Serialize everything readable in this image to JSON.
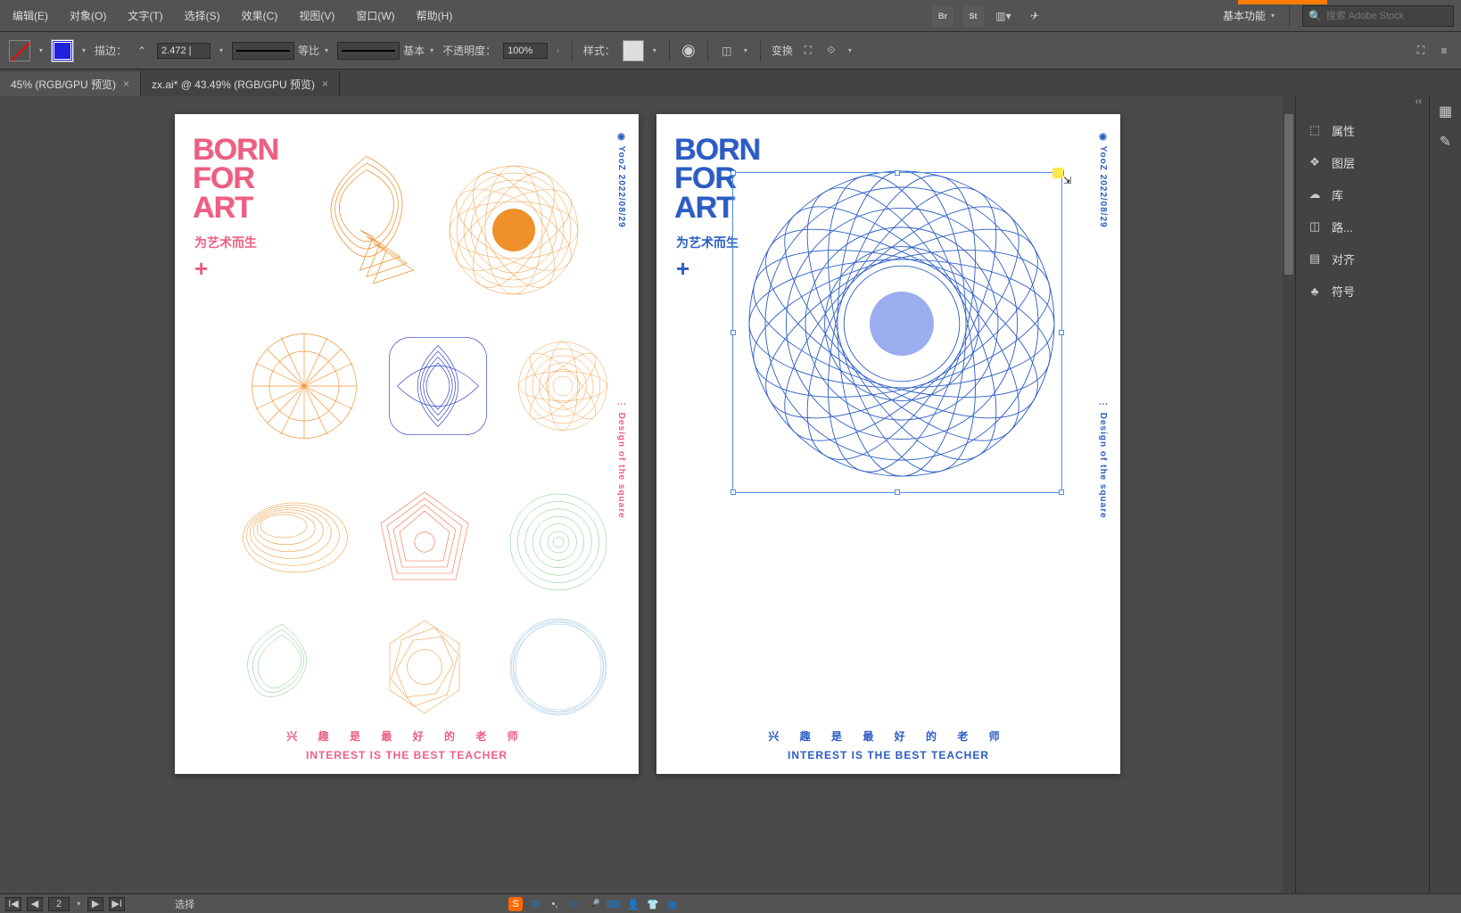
{
  "menu": {
    "items": [
      "编辑(E)",
      "对象(O)",
      "文字(T)",
      "选择(S)",
      "效果(C)",
      "视图(V)",
      "窗口(W)",
      "帮助(H)"
    ],
    "workspace": "基本功能",
    "search_placeholder": "搜索 Adobe Stock"
  },
  "control": {
    "stroke_label": "描边：",
    "stroke_weight": "2.472 |",
    "profile_label": "等比",
    "brush_label": "基本",
    "opacity_label": "不透明度：",
    "opacity_value": "100%",
    "style_label": "样式：",
    "transform_label": "变换"
  },
  "tabs": [
    {
      "label": "45% (RGB/GPU 预览)"
    },
    {
      "label": "zx.ai* @ 43.49% (RGB/GPU 预览)"
    }
  ],
  "panels": {
    "items": [
      {
        "icon": "cube",
        "label": "属性"
      },
      {
        "icon": "layers",
        "label": "图层"
      },
      {
        "icon": "cloud",
        "label": "库"
      },
      {
        "icon": "pathfinder",
        "label": "路..."
      },
      {
        "icon": "align",
        "label": "对齐"
      },
      {
        "icon": "symbol",
        "label": "符号"
      }
    ],
    "expand": "‹‹"
  },
  "status": {
    "artboard": "2",
    "tool": "选择"
  },
  "poster": {
    "title_l1": "BORN",
    "title_l2": "FOR",
    "title_l3": "ART",
    "subtitle": "为艺术而生",
    "plus": "+",
    "side1": "◉ YooZ   2022/08/29",
    "side2": "⋮    Design of the square",
    "bottom_cn": "兴 趣 是 最 好 的 老 师",
    "bottom_en": "INTEREST IS THE BEST TEACHER"
  },
  "ime": {
    "lang": "中",
    "punct": "•,"
  }
}
